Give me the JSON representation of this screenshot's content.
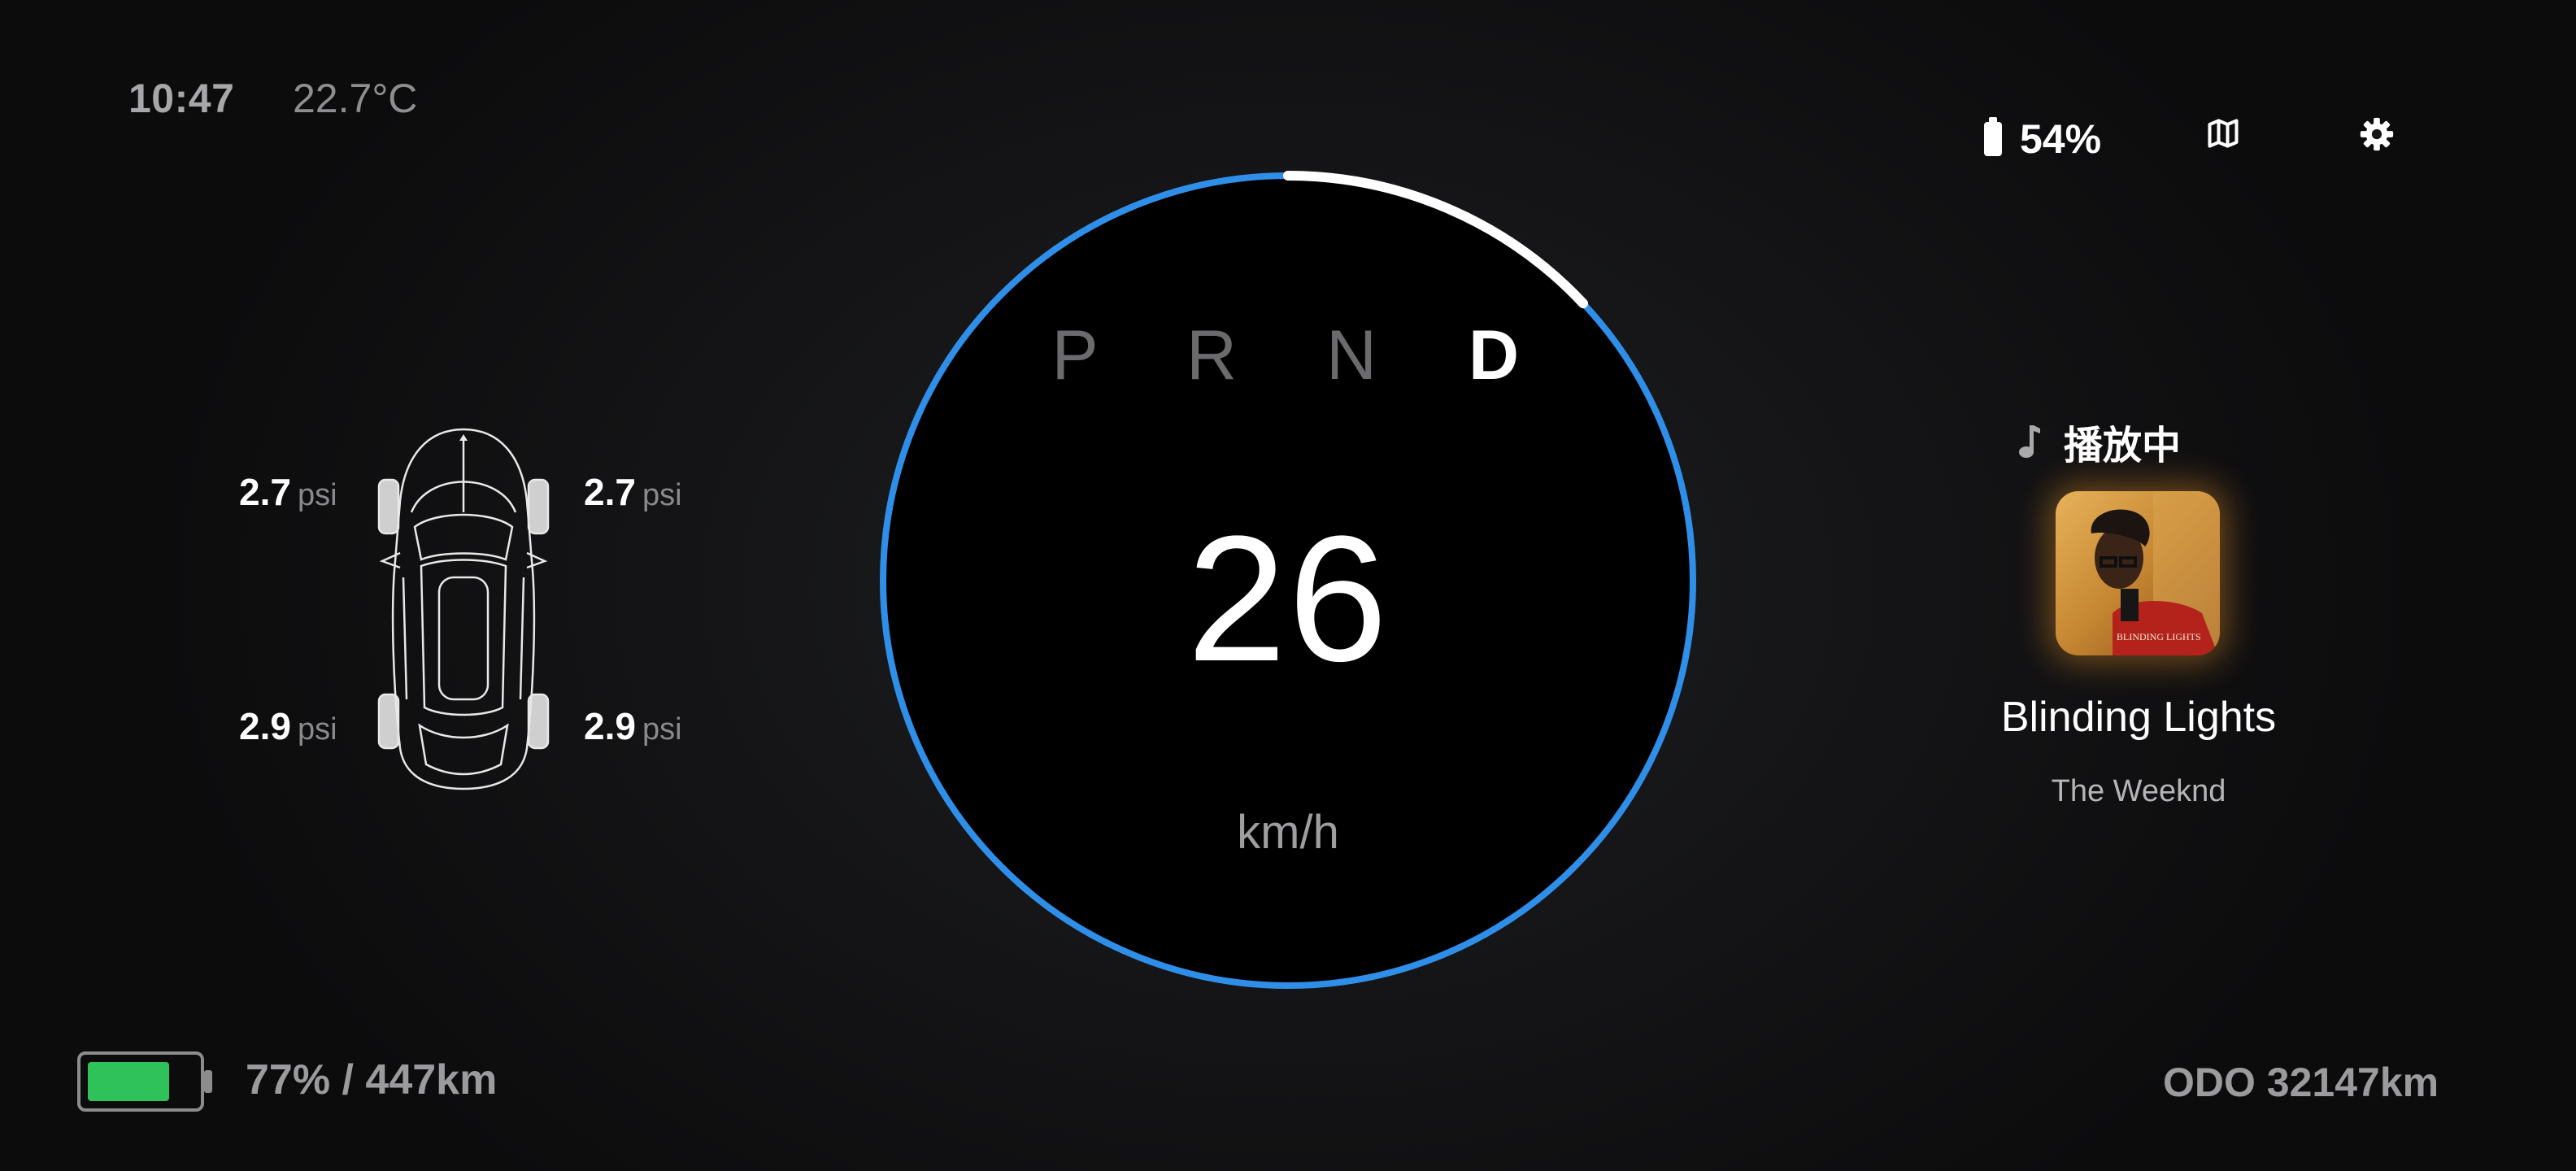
{
  "status": {
    "time": "10:47",
    "temperature": "22.7°C",
    "battery_percent_top": "54%"
  },
  "toolbar": {
    "map_icon": "map-icon",
    "settings_icon": "gear-icon"
  },
  "tires": {
    "front_left": {
      "value": "2.7",
      "unit": "psi"
    },
    "front_right": {
      "value": "2.7",
      "unit": "psi"
    },
    "rear_left": {
      "value": "2.9",
      "unit": "psi"
    },
    "rear_right": {
      "value": "2.9",
      "unit": "psi"
    }
  },
  "drive": {
    "gears": [
      "P",
      "R",
      "N",
      "D"
    ],
    "active_gear": "D",
    "speed": "26",
    "speed_unit": "km/h",
    "speed_arc_fraction": 0.13
  },
  "media": {
    "status_label": "播放中",
    "song_title": "Blinding Lights",
    "artist": "The Weeknd",
    "album_art_text": "BLINDING LIGHTS"
  },
  "bottom": {
    "battery_level": 0.77,
    "range_text": "77% / 447km",
    "odometer": "ODO 32147km"
  },
  "colors": {
    "ring_blue": "#2f8fe8",
    "battery_green": "#30c25a",
    "arc_white": "#ffffff"
  }
}
